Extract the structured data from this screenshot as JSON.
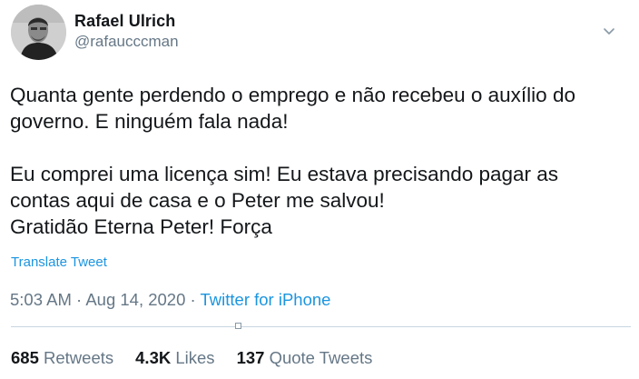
{
  "user": {
    "name": "Rafael Ulrich",
    "handle": "@rafaucccman",
    "avatar_icon": "profile-photo"
  },
  "menu_icon": "chevron-down-icon",
  "tweet": {
    "paragraph1": [
      "Quanta gente perdendo o emprego e não recebeu o auxílio do",
      "governo. E ninguém fala nada!"
    ],
    "paragraph2": [
      "Eu comprei uma licença sim! Eu estava precisando pagar as",
      "contas aqui de casa e o Peter me salvou!",
      "Gratidão Eterna Peter! Força"
    ]
  },
  "translate_label": "Translate Tweet",
  "meta": {
    "time": "5:03 AM",
    "separator": " · ",
    "date": "Aug 14, 2020",
    "source": "Twitter for iPhone"
  },
  "stats": {
    "retweets_count": "685",
    "retweets_label": "Retweets",
    "likes_count": "4.3K",
    "likes_label": "Likes",
    "quotes_count": "137",
    "quotes_label": "Quote Tweets"
  },
  "colors": {
    "text": "#14171a",
    "muted": "#657786",
    "link": "#1b95e0",
    "divider": "#c8d6df"
  }
}
